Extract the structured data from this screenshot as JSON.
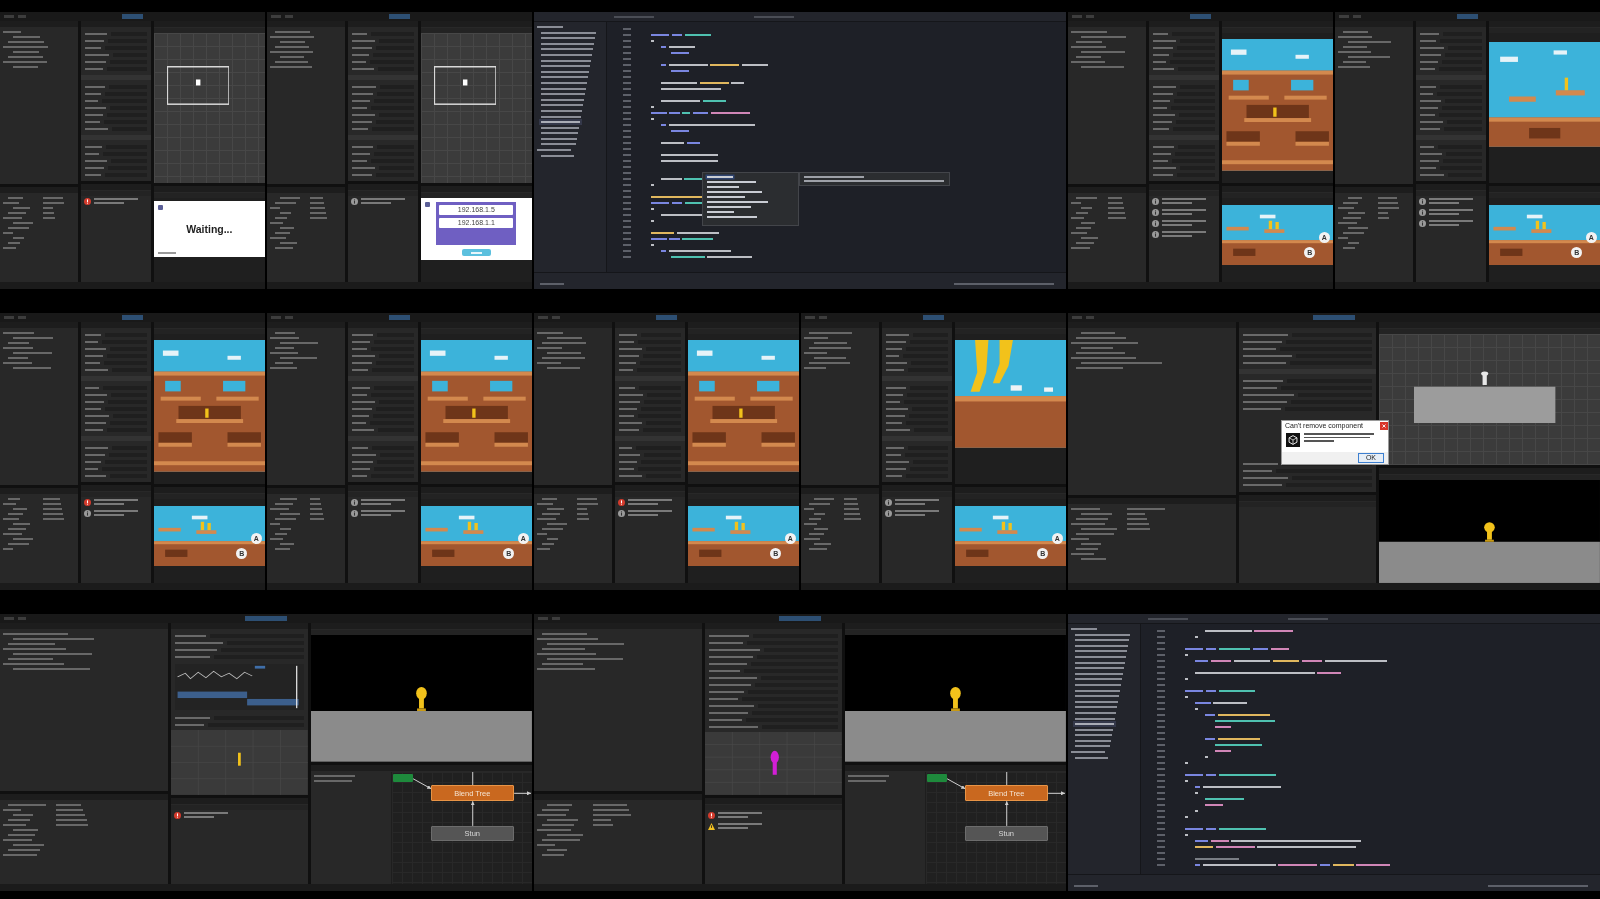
{
  "frames": [
    {
      "kind": "two-editors",
      "editors": [
        {
          "console": [
            {
              "kind": "error"
            }
          ],
          "scene": {
            "kind": "grid"
          },
          "game": {
            "kind": "waiting",
            "message": "Waiting..."
          }
        },
        {
          "console": [
            {
              "kind": "info"
            }
          ],
          "scene": {
            "kind": "grid"
          },
          "game": {
            "kind": "address-dialog",
            "addresses": [
              "192.168.1.5",
              "192.168.1.1"
            ]
          }
        }
      ]
    },
    {
      "kind": "code-editor",
      "completion_popup": true
    },
    {
      "kind": "two-editors",
      "editors": [
        {
          "console": [
            {
              "kind": "info"
            },
            {
              "kind": "info"
            },
            {
              "kind": "info"
            },
            {
              "kind": "info"
            }
          ],
          "scene": {
            "kind": "level"
          },
          "game": {
            "kind": "platforms",
            "touch_buttons": [
              "A",
              "B"
            ]
          }
        },
        {
          "console": [
            {
              "kind": "info"
            },
            {
              "kind": "info"
            },
            {
              "kind": "info"
            }
          ],
          "scene": {
            "kind": "level-top"
          },
          "game": {
            "kind": "platforms",
            "touch_buttons": [
              "A",
              "B"
            ]
          }
        }
      ]
    },
    {
      "kind": "two-editors",
      "editors": [
        {
          "console": [
            {
              "kind": "error"
            },
            {
              "kind": "info"
            }
          ],
          "scene": {
            "kind": "level"
          },
          "game": {
            "kind": "platforms",
            "touch_buttons": [
              "A",
              "B"
            ]
          }
        },
        {
          "console": [
            {
              "kind": "info"
            },
            {
              "kind": "info"
            }
          ],
          "scene": {
            "kind": "level"
          },
          "game": {
            "kind": "platforms",
            "touch_buttons": [
              "A",
              "B"
            ]
          }
        }
      ]
    },
    {
      "kind": "two-editors",
      "editors": [
        {
          "console": [
            {
              "kind": "error"
            },
            {
              "kind": "info"
            }
          ],
          "scene": {
            "kind": "level"
          },
          "game": {
            "kind": "platforms",
            "touch_buttons": [
              "A",
              "B"
            ]
          }
        },
        {
          "console": [
            {
              "kind": "info"
            },
            {
              "kind": "info"
            }
          ],
          "scene": {
            "kind": "closeup"
          },
          "game": {
            "kind": "platforms",
            "touch_buttons": [
              "A",
              "B"
            ]
          }
        }
      ]
    },
    {
      "kind": "editor-dialog",
      "scene": {
        "kind": "blocks"
      },
      "game": {
        "kind": "stage"
      },
      "dialog": {
        "title": "Can't remove component",
        "button": "OK"
      }
    },
    {
      "kind": "animator-editor",
      "inspector": {
        "kind": "blend-tree"
      },
      "console": [
        {
          "kind": "error"
        }
      ],
      "game": {
        "kind": "stage"
      },
      "nodes": [
        {
          "kind": "entry"
        },
        {
          "kind": "blend-tree",
          "label": "Blend Tree"
        },
        {
          "kind": "state",
          "label": "Stun"
        }
      ]
    },
    {
      "kind": "animator-editor",
      "inspector": {
        "kind": "clip"
      },
      "console": [
        {
          "kind": "error"
        },
        {
          "kind": "warning"
        }
      ],
      "game": {
        "kind": "stage"
      },
      "nodes": [
        {
          "kind": "entry"
        },
        {
          "kind": "blend-tree",
          "label": "Blend Tree"
        },
        {
          "kind": "state",
          "label": "Stun"
        }
      ]
    },
    {
      "kind": "code-editor",
      "completion_popup": false
    }
  ]
}
